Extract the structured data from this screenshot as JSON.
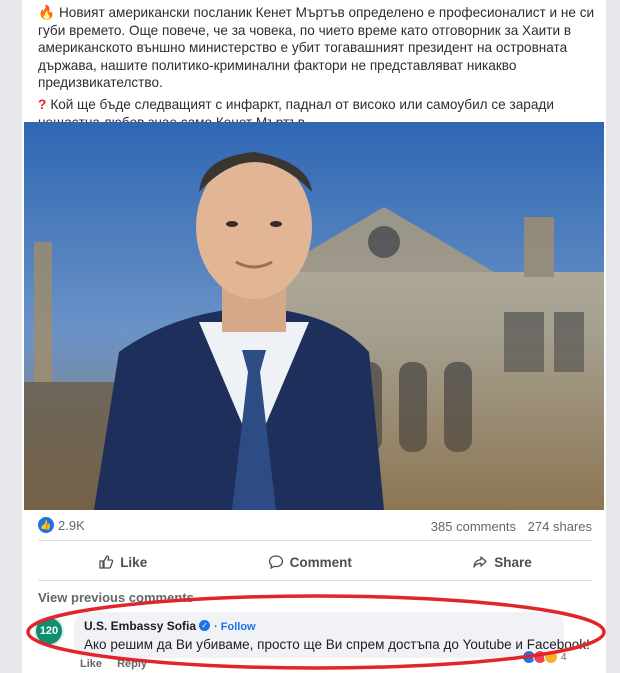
{
  "post": {
    "paragraph1": "Новият американски посланик Кенет Мъртъв определено е професионалист и не си губи времето. Още повече, че за човека, по чието време като отговорник за Хаити в американското външно министерство е убит тогавашният президент на островната държава, нашите политико-криминални фактори не представляват никакво предизвикателство.",
    "paragraph2": "Кой ще бъде следващият с инфаркт, паднал от високо или самоубил се заради нещастна любов знае само Кенет Мъртъв.",
    "paragraph1_icon": "fire-icon",
    "paragraph2_icon": "red-question-mark-icon"
  },
  "stats": {
    "reactions_count": "2.9K",
    "comments": "385 comments",
    "shares": "274 shares"
  },
  "actions": {
    "like": "Like",
    "comment": "Comment",
    "share": "Share"
  },
  "comments_section": {
    "view_previous": "View previous comments",
    "comment": {
      "avatar_text": "120",
      "author": "U.S. Embassy Sofia",
      "follow": "· Follow",
      "text": "Ако решим да Ви убиваме, просто ще Ви спрем достъпа до Youtube и Facebook!",
      "like": "Like",
      "reply": "Reply",
      "reaction_count": "4"
    }
  },
  "colors": {
    "accent": "#1b74e4",
    "annotation": "#e0262b"
  }
}
